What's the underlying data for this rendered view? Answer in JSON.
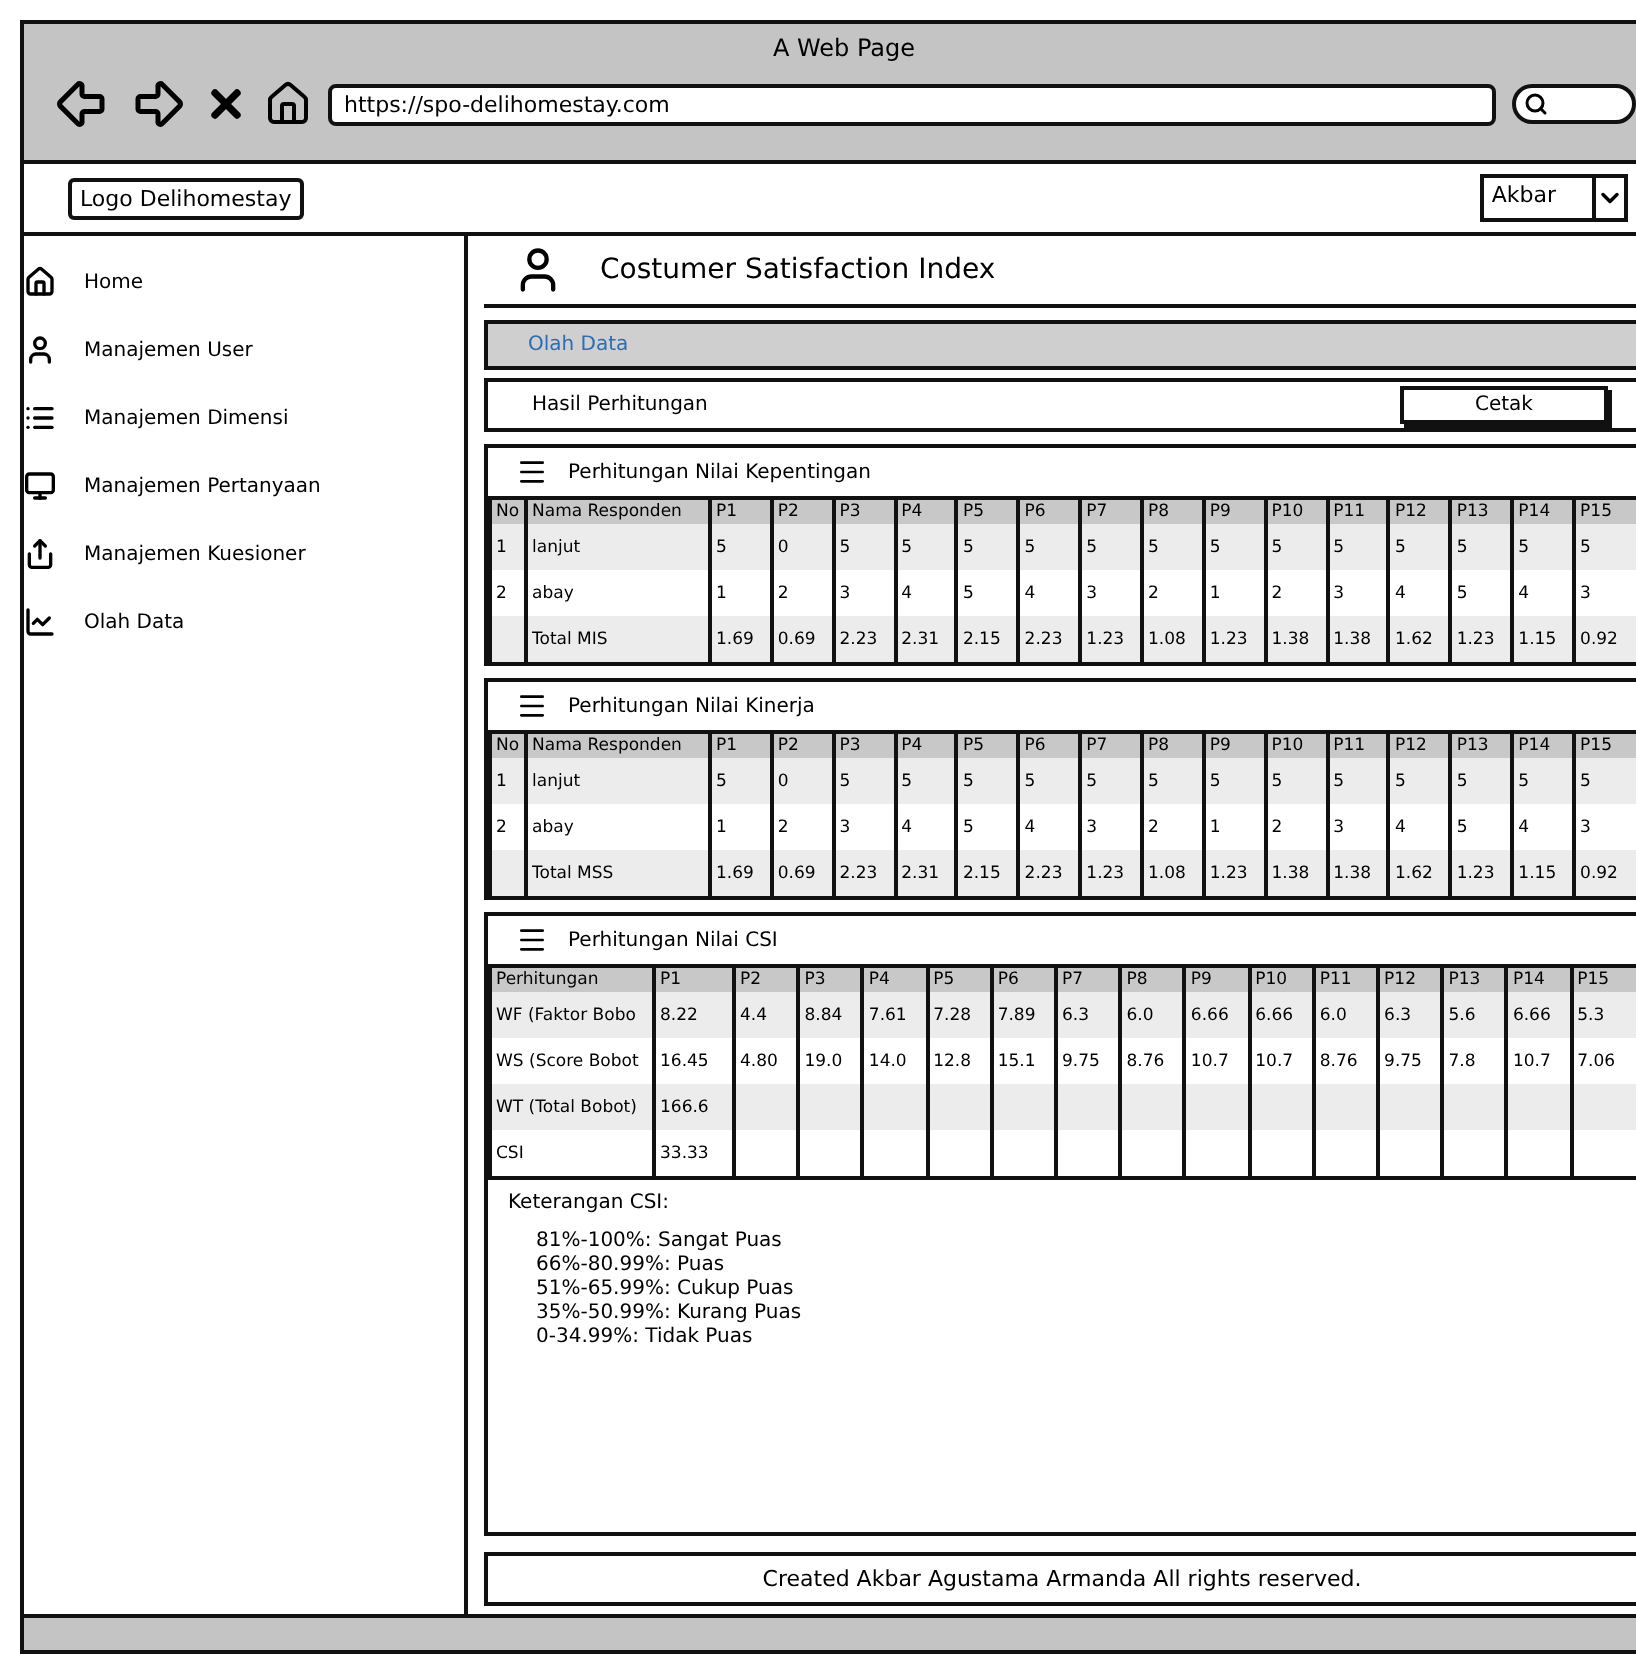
{
  "browser": {
    "title": "A Web Page",
    "url": "https://spo-delihomestay.com"
  },
  "header": {
    "logo": "Logo Delihomestay",
    "user": "Akbar"
  },
  "sidebar": {
    "items": [
      {
        "label": "Home"
      },
      {
        "label": "Manajemen User"
      },
      {
        "label": "Manajemen Dimensi"
      },
      {
        "label": "Manajemen Pertanyaan"
      },
      {
        "label": "Manajemen Kuesioner"
      },
      {
        "label": "Olah Data"
      }
    ]
  },
  "page": {
    "title": "Costumer Satisfaction Index",
    "breadcrumb": "Olah Data",
    "result_label": "Hasil Perhitungan",
    "print_button": "Cetak"
  },
  "tables": [
    {
      "title": "Perhitungan Nilai Kepentingan",
      "columns": [
        "No",
        "Nama Responden",
        "P1",
        "P2",
        "P3",
        "P4",
        "P5",
        "P6",
        "P7",
        "P8",
        "P9",
        "P10",
        "P11",
        "P12",
        "P13",
        "P14",
        "P15"
      ],
      "rows": [
        [
          "1",
          "lanjut",
          "5",
          "0",
          "5",
          "5",
          "5",
          "5",
          "5",
          "5",
          "5",
          "5",
          "5",
          "5",
          "5",
          "5",
          "5"
        ],
        [
          "2",
          "abay",
          "1",
          "2",
          "3",
          "4",
          "5",
          "4",
          "3",
          "2",
          "1",
          "2",
          "3",
          "4",
          "5",
          "4",
          "3"
        ],
        [
          "",
          "Total MIS",
          "1.69",
          "0.69",
          "2.23",
          "2.31",
          "2.15",
          "2.23",
          "1.23",
          "1.08",
          "1.23",
          "1.38",
          "1.38",
          "1.62",
          "1.23",
          "1.15",
          "0.92"
        ]
      ]
    },
    {
      "title": "Perhitungan Nilai Kinerja",
      "columns": [
        "No",
        "Nama Responden",
        "P1",
        "P2",
        "P3",
        "P4",
        "P5",
        "P6",
        "P7",
        "P8",
        "P9",
        "P10",
        "P11",
        "P12",
        "P13",
        "P14",
        "P15"
      ],
      "rows": [
        [
          "1",
          "lanjut",
          "5",
          "0",
          "5",
          "5",
          "5",
          "5",
          "5",
          "5",
          "5",
          "5",
          "5",
          "5",
          "5",
          "5",
          "5"
        ],
        [
          "2",
          "abay",
          "1",
          "2",
          "3",
          "4",
          "5",
          "4",
          "3",
          "2",
          "1",
          "2",
          "3",
          "4",
          "5",
          "4",
          "3"
        ],
        [
          "",
          "Total MSS",
          "1.69",
          "0.69",
          "2.23",
          "2.31",
          "2.15",
          "2.23",
          "1.23",
          "1.08",
          "1.23",
          "1.38",
          "1.38",
          "1.62",
          "1.23",
          "1.15",
          "0.92"
        ]
      ]
    },
    {
      "title": "Perhitungan Nilai CSI",
      "columns": [
        "Perhitungan",
        "P1",
        "P2",
        "P3",
        "P4",
        "P5",
        "P6",
        "P7",
        "P8",
        "P9",
        "P10",
        "P11",
        "P12",
        "P13",
        "P14",
        "P15"
      ],
      "rows": [
        [
          "WF (Faktor Bobo",
          "8.22",
          "4.4",
          "8.84",
          "7.61",
          "7.28",
          "7.89",
          "6.3",
          "6.0",
          "6.66",
          "6.66",
          "6.0",
          "6.3",
          "5.6",
          "6.66",
          "5.3"
        ],
        [
          "WS (Score Bobot",
          "16.45",
          "4.80",
          "19.0",
          "14.0",
          "12.8",
          "15.1",
          "9.75",
          "8.76",
          "10.7",
          "10.7",
          "8.76",
          "9.75",
          "7.8",
          "10.7",
          "7.06"
        ],
        [
          "WT (Total Bobot)",
          "166.6"
        ],
        [
          "CSI",
          "33.33"
        ]
      ]
    }
  ],
  "legend": {
    "title": "Keterangan CSI:",
    "lines": [
      "81%-100%: Sangat Puas",
      "66%-80.99%: Puas",
      "51%-65.99%: Cukup Puas",
      "35%-50.99%: Kurang Puas",
      "0-34.99%: Tidak Puas"
    ]
  },
  "footer": "Created Akbar Agustama Armanda All rights reserved."
}
